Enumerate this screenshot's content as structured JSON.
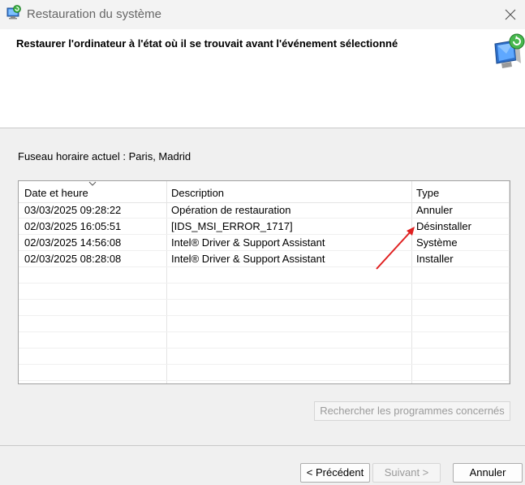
{
  "window": {
    "title": "Restauration du système",
    "close_icon": "close-icon",
    "app_icon": "system-restore-icon"
  },
  "header": {
    "title": "Restaurer l'ordinateur à l'état où il se trouvait avant l'événement sélectionné",
    "icon": "system-restore-computer-icon"
  },
  "timezone_label": "Fuseau horaire actuel : Paris, Madrid",
  "table": {
    "columns": [
      "Date et heure",
      "Description",
      "Type"
    ],
    "sort_indicator": "sort-descending-icon",
    "rows": [
      {
        "date": "03/03/2025 09:28:22",
        "description": "Opération de restauration",
        "type": "Annuler"
      },
      {
        "date": "02/03/2025 16:05:51",
        "description": "[IDS_MSI_ERROR_1717]",
        "type": "Désinstaller"
      },
      {
        "date": "02/03/2025 14:56:08",
        "description": "Intel® Driver & Support Assistant",
        "type": "Système"
      },
      {
        "date": "02/03/2025 08:28:08",
        "description": "Intel® Driver & Support Assistant",
        "type": "Installer"
      }
    ]
  },
  "buttons": {
    "search_affected": "Rechercher les programmes concernés",
    "back": "< Précédent",
    "next": "Suivant >",
    "cancel": "Annuler"
  },
  "annotation": {
    "arrow_color": "#e02020"
  }
}
